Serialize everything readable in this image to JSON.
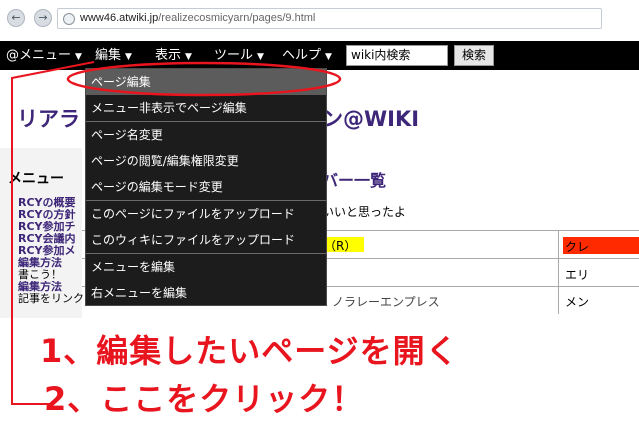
{
  "browser": {
    "url_host": "www46.atwiki.jp",
    "url_path": "/realizecosmicyarn/pages/9.html"
  },
  "menubar": {
    "items": [
      "@メニュー",
      "編集",
      "表示",
      "ツール",
      "ヘルプ"
    ],
    "search_value": "wiki内検索",
    "search_button": "検索"
  },
  "page": {
    "title_left": "リアラ",
    "title_right": "ン@WIKI",
    "sidebar_heading": "メニュー",
    "sidebar_items": [
      "RCYの概要",
      "RCYの方針",
      "RCY参加チ",
      "RCY会議内",
      "RCY参加メ",
      "編集方法",
      "書こう！",
      "編集方法",
      "記事をリンクしよう！"
    ],
    "member_heading": "バー一覧",
    "member_note": "いいと思ったよ",
    "table_cells": [
      "（R）",
      "クレ",
      "エリ",
      "ノラレーエンプレス",
      "メン"
    ]
  },
  "dropdown": {
    "items": [
      "ページ編集",
      "メニュー非表示でページ編集",
      "ページ名変更",
      "ページの閲覧/編集権限変更",
      "ページの編集モード変更",
      "このページにファイルをアップロード",
      "このウィキにファイルをアップロード",
      "メニューを編集",
      "右メニューを編集"
    ]
  },
  "annotations": {
    "step1": "1、編集したいページを開く",
    "step2": "2、ここをクリック！"
  },
  "colors": {
    "annotation_red": "#e8141e",
    "menubar_bg": "#000000",
    "dropdown_bg": "#1c1c1c",
    "title_purple": "#3e2779",
    "highlight_yellow": "#ffff00",
    "highlight_red": "#ff2a00"
  }
}
